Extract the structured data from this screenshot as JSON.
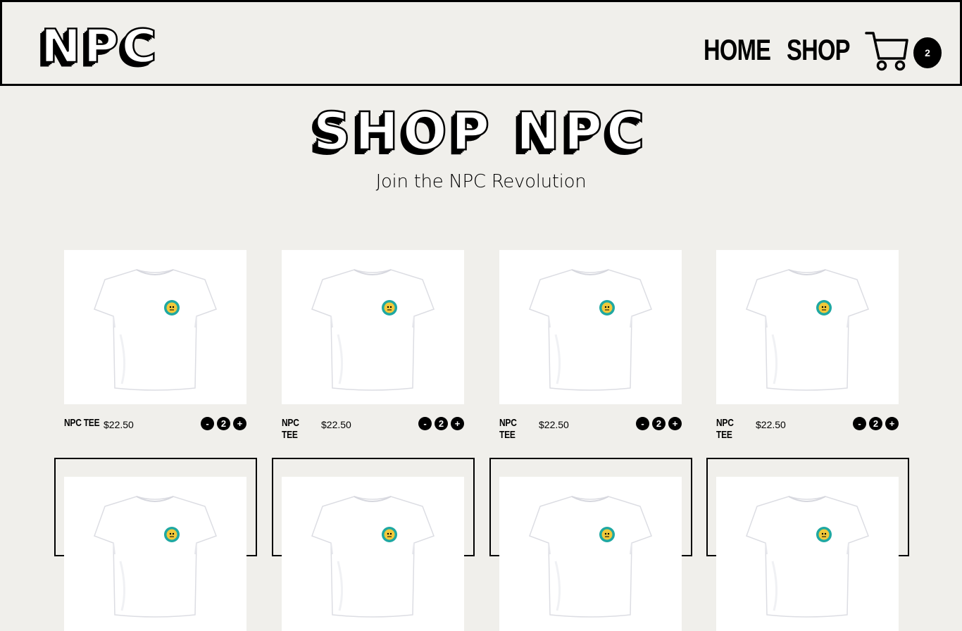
{
  "header": {
    "logo": "NPC",
    "nav": {
      "home": "HOME",
      "shop": "SHOP"
    },
    "cart": {
      "icon": "cart-icon",
      "count": "2"
    }
  },
  "hero": {
    "title": "SHOP NPC",
    "subtitle": "Join the NPC Revolution"
  },
  "products": [
    {
      "name": "NPC TEE",
      "price": "$22.50",
      "qty": "2",
      "minus": "-",
      "plus": "+"
    },
    {
      "name": "NPC TEE",
      "price": "$22.50",
      "qty": "2",
      "minus": "-",
      "plus": "+"
    },
    {
      "name": "NPC TEE",
      "price": "$22.50",
      "qty": "2",
      "minus": "-",
      "plus": "+"
    },
    {
      "name": "NPC TEE",
      "price": "$22.50",
      "qty": "2",
      "minus": "-",
      "plus": "+"
    }
  ],
  "colors": {
    "background": "#f0efeb",
    "ink": "#000000",
    "badge_teal": "#1fa8a2",
    "badge_yellow": "#f2c93a"
  }
}
